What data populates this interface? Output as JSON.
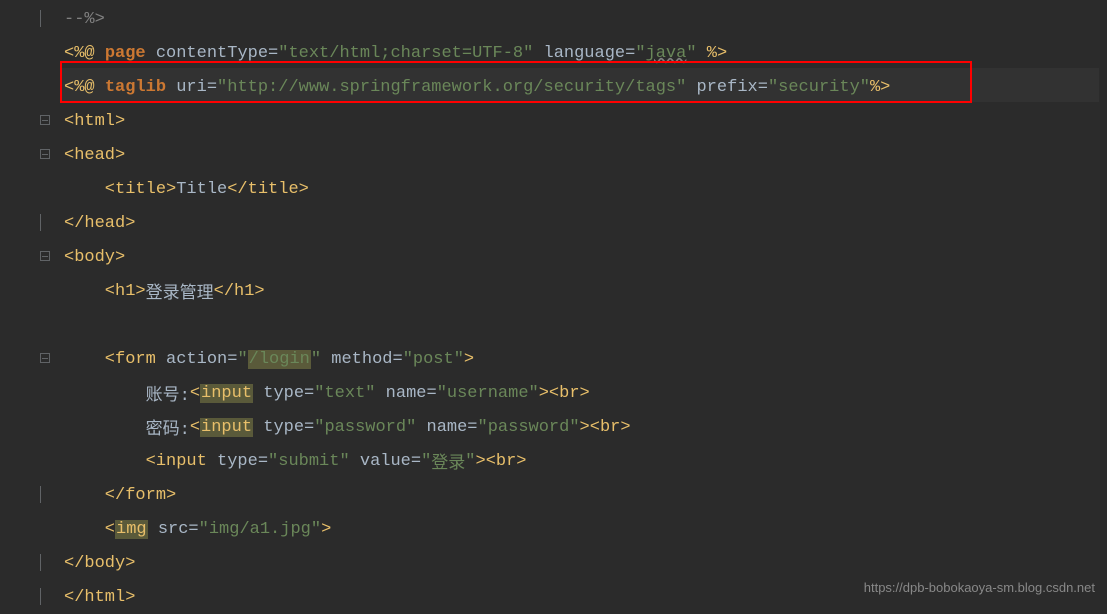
{
  "lines": {
    "l1": "--%>",
    "l2_open": "<%@ ",
    "l2_page": "page",
    "l2_ct_attr": " contentType=",
    "l2_ct_q": "\"",
    "l2_ct_val": "text/html;charset=UTF-8",
    "l2_lang_attr": " language=",
    "l2_lang_val": "java",
    "l2_close": " %>",
    "l3_open": "<%@ ",
    "l3_taglib": "taglib",
    "l3_uri_attr": " uri=",
    "l3_uri_q": "\"",
    "l3_uri_val": "http://www.springframework.org/security/tags",
    "l3_prefix_attr": " prefix=",
    "l3_prefix_val": "security",
    "l3_close": "%>",
    "l4": "<html>",
    "l5": "<head>",
    "l6_open": "    <title>",
    "l6_text": "Title",
    "l6_close": "</title>",
    "l7": "</head>",
    "l8": "<body>",
    "l9_open": "    <h1>",
    "l9_text": "登录管理",
    "l9_close": "</h1>",
    "l11_open": "    <form",
    "l11_action_attr": " action=",
    "l11_action_q": "\"",
    "l11_action_val": "/login",
    "l11_method_attr": " method=",
    "l11_method_val": "post",
    "l11_close": ">",
    "l12_label": "        账号:",
    "l12_input": "<input",
    "l12_type_attr": " type=",
    "l12_type_val": "text",
    "l12_name_attr": " name=",
    "l12_name_val": "username",
    "l12_br": "><br>",
    "l13_label": "        密码:",
    "l13_input": "<input",
    "l13_type_attr": " type=",
    "l13_type_val": "password",
    "l13_name_attr": " name=",
    "l13_name_val": "password",
    "l13_br": "><br>",
    "l14_open": "        <input",
    "l14_type_attr": " type=",
    "l14_type_val": "submit",
    "l14_value_attr": " value=",
    "l14_value_val": "登录",
    "l14_br": "><br>",
    "l15": "    </form>",
    "l16_open": "    <img",
    "l16_src_attr": " src=",
    "l16_src_val": "img/a1.jpg",
    "l16_close": ">",
    "l17": "</body>",
    "l18": "</html>"
  },
  "watermark": "https://dpb-bobokaoya-sm.blog.csdn.net"
}
